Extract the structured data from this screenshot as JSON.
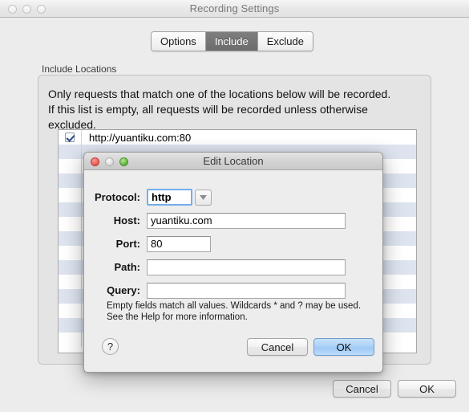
{
  "window": {
    "title": "Recording Settings",
    "traffic_lights": [
      "close",
      "minimize",
      "zoom"
    ]
  },
  "tabs": [
    {
      "label": "Options",
      "selected": false
    },
    {
      "label": "Include",
      "selected": true
    },
    {
      "label": "Exclude",
      "selected": false
    }
  ],
  "group": {
    "label": "Include Locations",
    "description_line1": "Only requests that match one of the locations below will be recorded.",
    "description_line2": "If this list is empty, all requests will be recorded unless otherwise",
    "description_line3": "excluded."
  },
  "table": {
    "rows": [
      {
        "checked": true,
        "label": "http://yuantiku.com:80"
      }
    ],
    "empty_row_count": 14
  },
  "window_buttons": {
    "cancel": "Cancel",
    "ok": "OK"
  },
  "dialog": {
    "title": "Edit Location",
    "traffic_lights": [
      "close",
      "minimize",
      "zoom"
    ],
    "fields": [
      {
        "label": "Protocol:",
        "value": "http",
        "placeholder": "",
        "type": "combo"
      },
      {
        "label": "Host:",
        "value": "yuantiku.com",
        "placeholder": "",
        "type": "text"
      },
      {
        "label": "Port:",
        "value": "80",
        "placeholder": "",
        "type": "text"
      },
      {
        "label": "Path:",
        "value": "",
        "placeholder": "",
        "type": "text"
      },
      {
        "label": "Query:",
        "value": "",
        "placeholder": "",
        "type": "text"
      }
    ],
    "protocol_options": [
      "http"
    ],
    "hint_line1": "Empty fields match all values. Wildcards * and ? may be used.",
    "hint_line2": "See the Help for more information.",
    "help_label": "?",
    "cancel": "Cancel",
    "ok": "OK"
  },
  "colors": {
    "accent_blue": "#9ec8f4",
    "tab_selected_bg": "#6c6c6c",
    "stripe_blue": "#dde4ef",
    "focus_ring": "#75aeea"
  }
}
